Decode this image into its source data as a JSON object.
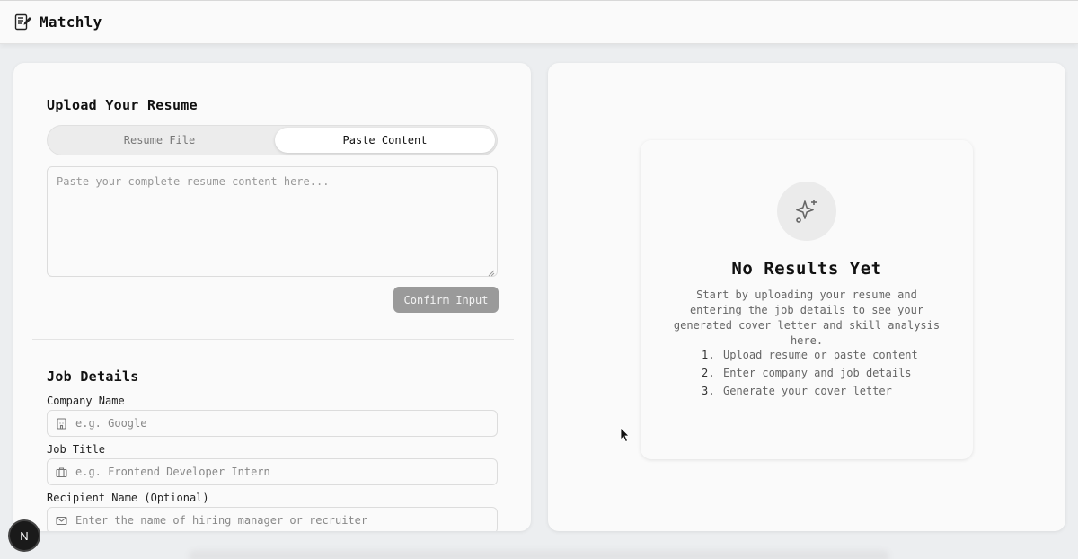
{
  "app": {
    "title": "Matchly",
    "logo_icon": "resume-document-icon"
  },
  "resume": {
    "heading": "Upload Your Resume",
    "tabs": [
      {
        "label": "Resume File",
        "active": false
      },
      {
        "label": "Paste Content",
        "active": true
      }
    ],
    "textarea_placeholder": "Paste your complete resume content here...",
    "confirm_label": "Confirm Input"
  },
  "job": {
    "heading": "Job Details",
    "fields": [
      {
        "label": "Company Name",
        "placeholder": "e.g. Google",
        "icon": "building-icon"
      },
      {
        "label": "Job Title",
        "placeholder": "e.g. Frontend Developer Intern",
        "icon": "briefcase-icon"
      },
      {
        "label": "Recipient Name (Optional)",
        "placeholder": "Enter the name of hiring manager or recruiter",
        "icon": "mail-icon"
      }
    ]
  },
  "results": {
    "icon": "sparkles-icon",
    "title": "No Results Yet",
    "description": "Start by uploading your resume and entering the job details to see your generated cover letter and skill analysis here.",
    "steps": [
      {
        "num": "1.",
        "text": "Upload resume or paste content"
      },
      {
        "num": "2.",
        "text": "Enter company and job details"
      },
      {
        "num": "3.",
        "text": "Generate your cover letter"
      }
    ]
  },
  "dev_badge": {
    "label": "N"
  },
  "colors": {
    "background": "#eceef0",
    "panel": "#fafafa",
    "button_disabled": "#9a9a9a",
    "text": "#111111"
  }
}
